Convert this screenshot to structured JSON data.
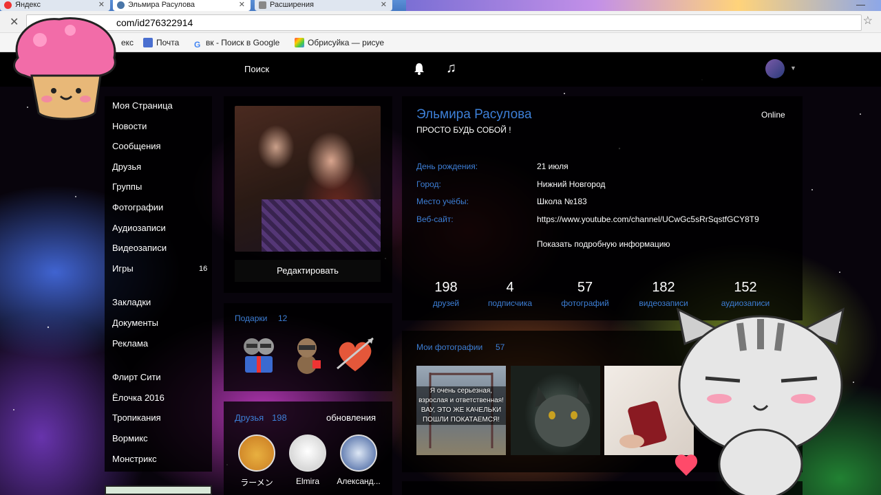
{
  "browser": {
    "tabs": [
      {
        "label": "Яндекс",
        "active": false
      },
      {
        "label": "Эльмира Расулова",
        "active": true
      },
      {
        "label": "Расширения",
        "active": false
      }
    ],
    "url_visible": "com/id276322914",
    "bookmarks": [
      {
        "label": "Почта",
        "icon": "mail-icon"
      },
      {
        "label": "вк - Поиск в Google",
        "icon": "google-icon"
      },
      {
        "label": "Обрисуйка — рисуе",
        "icon": "obrisuyka-icon"
      }
    ],
    "bookmark_partial_left": "екс"
  },
  "topnav": {
    "search_label": "Поиск"
  },
  "left_menu": {
    "items": [
      {
        "label": "Моя Страница"
      },
      {
        "label": "Новости"
      },
      {
        "label": "Сообщения"
      },
      {
        "label": "Друзья"
      },
      {
        "label": "Группы"
      },
      {
        "label": "Фотографии"
      },
      {
        "label": "Аудиозаписи"
      },
      {
        "label": "Видеозаписи"
      },
      {
        "label": "Игры",
        "count": "16"
      }
    ],
    "secondary": [
      {
        "label": "Закладки"
      },
      {
        "label": "Документы"
      },
      {
        "label": "Реклама"
      }
    ],
    "apps": [
      {
        "label": "Флирт Сити"
      },
      {
        "label": "Ёлочка 2016"
      },
      {
        "label": "Тропикания"
      },
      {
        "label": "Вормикс"
      },
      {
        "label": "Монстрикс"
      }
    ]
  },
  "profile": {
    "edit_button": "Редактировать",
    "name": "Эльмира Расулова",
    "status": "ПРОСТО БУДЬ СОБОЙ !",
    "online": "Online",
    "info": [
      {
        "key": "День рождения:",
        "value": "21 июля"
      },
      {
        "key": "Город:",
        "value": "Нижний Новгород"
      },
      {
        "key": "Место учёбы:",
        "value": "Школа №183"
      },
      {
        "key": "Веб-сайт:",
        "value": "https://www.youtube.com/channel/UCwGc5sRrSqstfGCY8T9"
      }
    ],
    "more_info": "Показать подробную информацию",
    "stats": [
      {
        "count": "198",
        "label": "друзей"
      },
      {
        "count": "4",
        "label": "подписчика"
      },
      {
        "count": "57",
        "label": "фотографий"
      },
      {
        "count": "182",
        "label": "видеозаписи"
      },
      {
        "count": "152",
        "label": "аудиозаписи"
      }
    ]
  },
  "gifts": {
    "title": "Подарки",
    "count": "12"
  },
  "friends": {
    "title": "Друзья",
    "count": "198",
    "updates_label": "обновления",
    "list": [
      {
        "name": "ラーメン"
      },
      {
        "name": "Elmira"
      },
      {
        "name": "Александ..."
      }
    ]
  },
  "photos": {
    "title": "Мои фотографии",
    "count": "57",
    "first_caption": "Я очень серьезная, взрослая и ответственная! ВАУ, ЭТО ЖЕ КАЧЕЛЬКИ ПОШЛИ ПОКАТАЕМСЯ!"
  },
  "colors": {
    "link_blue": "#3d7fd6",
    "panel_bg": "rgba(0,0,0,0.78)"
  }
}
